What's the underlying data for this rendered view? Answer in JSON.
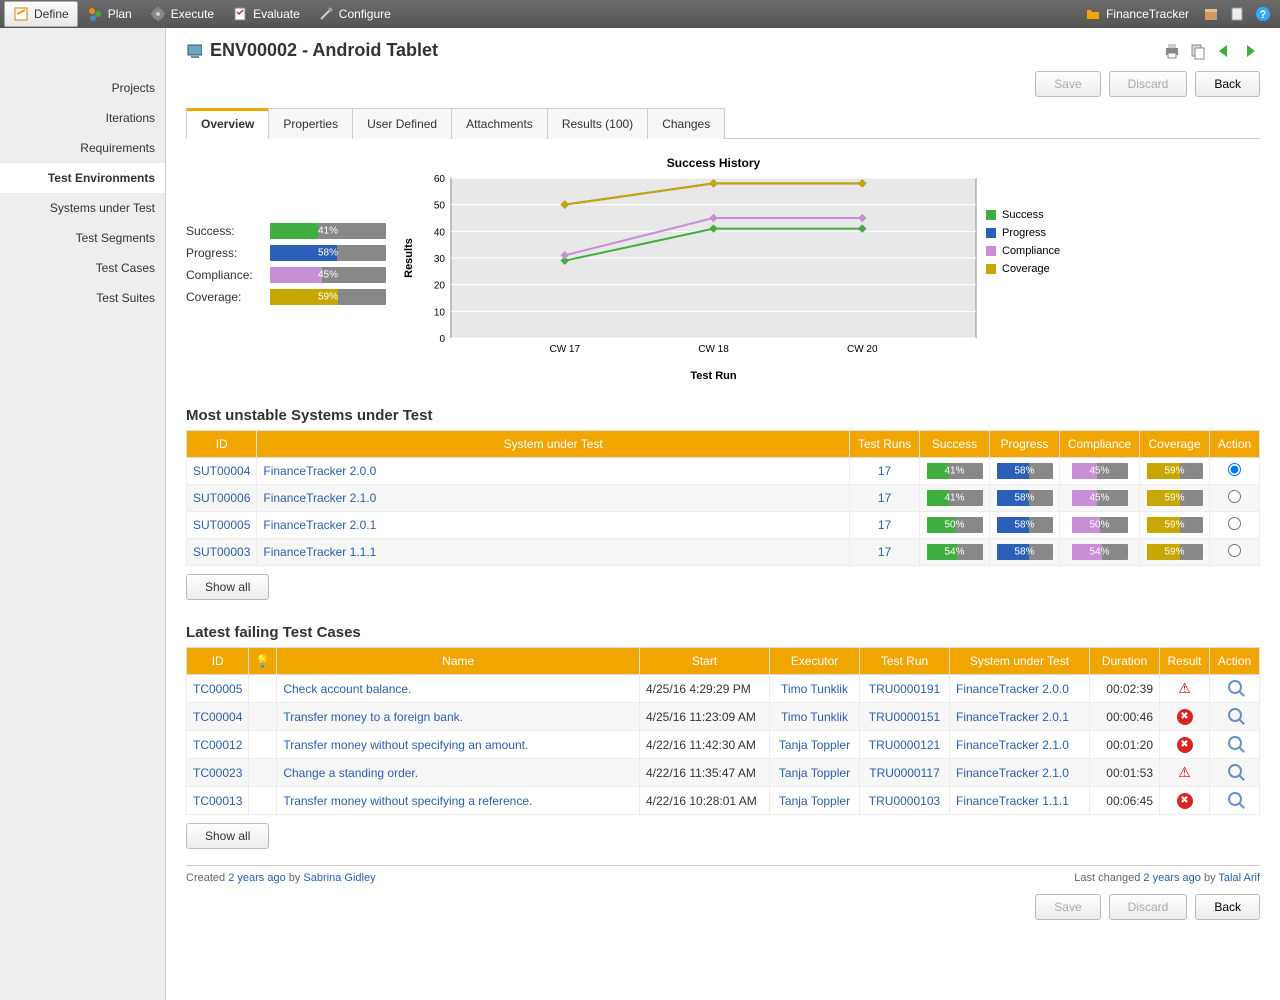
{
  "toolbar": {
    "items": [
      {
        "label": "Define",
        "active": true
      },
      {
        "label": "Plan"
      },
      {
        "label": "Execute"
      },
      {
        "label": "Evaluate"
      },
      {
        "label": "Configure"
      }
    ],
    "project": "FinanceTracker"
  },
  "sidebar": {
    "items": [
      "Projects",
      "Iterations",
      "Requirements",
      "Test Environments",
      "Systems under Test",
      "Test Segments",
      "Test Cases",
      "Test Suites"
    ],
    "active": 3
  },
  "page": {
    "title": "ENV00002 - Android Tablet",
    "buttons": {
      "save": "Save",
      "discard": "Discard",
      "back": "Back"
    },
    "tabs": [
      "Overview",
      "Properties",
      "User Defined",
      "Attachments",
      "Results (100)",
      "Changes"
    ],
    "activeTab": 0
  },
  "summary": {
    "rows": [
      {
        "label": "Success:",
        "pct": 41,
        "color": "#3fae3f"
      },
      {
        "label": "Progress:",
        "pct": 58,
        "color": "#2b5fb8"
      },
      {
        "label": "Compliance:",
        "pct": 45,
        "color": "#c88fd6"
      },
      {
        "label": "Coverage:",
        "pct": 59,
        "color": "#c8a600"
      }
    ]
  },
  "chart_data": {
    "type": "line",
    "title": "Success History",
    "xlabel": "Test Run",
    "ylabel": "Results",
    "categories": [
      "CW 17",
      "CW 18",
      "CW 20"
    ],
    "ylim": [
      0,
      60
    ],
    "yticks": [
      0,
      10,
      20,
      30,
      40,
      50,
      60
    ],
    "series": [
      {
        "name": "Success",
        "color": "#3fae3f",
        "values": [
          29,
          41,
          41
        ]
      },
      {
        "name": "Progress",
        "color": "#2b5fb8",
        "values": [
          50,
          58,
          58
        ]
      },
      {
        "name": "Compliance",
        "color": "#c88fd6",
        "values": [
          31,
          45,
          45
        ]
      },
      {
        "name": "Coverage",
        "color": "#c8a600",
        "values": [
          50,
          58,
          58
        ]
      }
    ],
    "legend": [
      "Success",
      "Progress",
      "Compliance",
      "Coverage"
    ]
  },
  "unstable": {
    "title": "Most unstable Systems under Test",
    "headers": [
      "ID",
      "System under Test",
      "Test Runs",
      "Success",
      "Progress",
      "Compliance",
      "Coverage",
      "Action"
    ],
    "rows": [
      {
        "id": "SUT00004",
        "name": "FinanceTracker 2.0.0",
        "runs": 17,
        "success": 41,
        "progress": 58,
        "compliance": 45,
        "coverage": 59,
        "selected": true
      },
      {
        "id": "SUT00006",
        "name": "FinanceTracker 2.1.0",
        "runs": 17,
        "success": 41,
        "progress": 58,
        "compliance": 45,
        "coverage": 59,
        "selected": false
      },
      {
        "id": "SUT00005",
        "name": "FinanceTracker 2.0.1",
        "runs": 17,
        "success": 50,
        "progress": 58,
        "compliance": 50,
        "coverage": 59,
        "selected": false
      },
      {
        "id": "SUT00003",
        "name": "FinanceTracker 1.1.1",
        "runs": 17,
        "success": 54,
        "progress": 58,
        "compliance": 54,
        "coverage": 59,
        "selected": false
      }
    ],
    "showAll": "Show all"
  },
  "failing": {
    "title": "Latest failing Test Cases",
    "headers": [
      "ID",
      "",
      "Name",
      "Start",
      "Executor",
      "Test Run",
      "System under Test",
      "Duration",
      "Result",
      "Action"
    ],
    "rows": [
      {
        "id": "TC00005",
        "name": "Check account balance.",
        "start": "4/25/16 4:29:29 PM",
        "executor": "Timo Tunklik",
        "run": "TRU0000191",
        "sut": "FinanceTracker 2.0.0",
        "dur": "00:02:39",
        "res": "warn"
      },
      {
        "id": "TC00004",
        "name": "Transfer money to a foreign bank.",
        "start": "4/25/16 11:23:09 AM",
        "executor": "Timo Tunklik",
        "run": "TRU0000151",
        "sut": "FinanceTracker 2.0.1",
        "dur": "00:00:46",
        "res": "fail"
      },
      {
        "id": "TC00012",
        "name": "Transfer money without specifying an amount.",
        "start": "4/22/16 11:42:30 AM",
        "executor": "Tanja Toppler",
        "run": "TRU0000121",
        "sut": "FinanceTracker 2.1.0",
        "dur": "00:01:20",
        "res": "fail"
      },
      {
        "id": "TC00023",
        "name": "Change a standing order.",
        "start": "4/22/16 11:35:47 AM",
        "executor": "Tanja Toppler",
        "run": "TRU0000117",
        "sut": "FinanceTracker 2.1.0",
        "dur": "00:01:53",
        "res": "warn"
      },
      {
        "id": "TC00013",
        "name": "Transfer money without specifying a reference.",
        "start": "4/22/16 10:28:01 AM",
        "executor": "Tanja Toppler",
        "run": "TRU0000103",
        "sut": "FinanceTracker 1.1.1",
        "dur": "00:06:45",
        "res": "fail"
      }
    ],
    "showAll": "Show all"
  },
  "footer": {
    "createdPrefix": "Created ",
    "createdTime": "2 years ago",
    "createdBy": " by ",
    "createdUser": "Sabrina Gidley",
    "changedPrefix": "Last changed ",
    "changedTime": "2 years ago",
    "changedBy": " by ",
    "changedUser": "Talal Arif"
  },
  "bulbHeader": "💡"
}
